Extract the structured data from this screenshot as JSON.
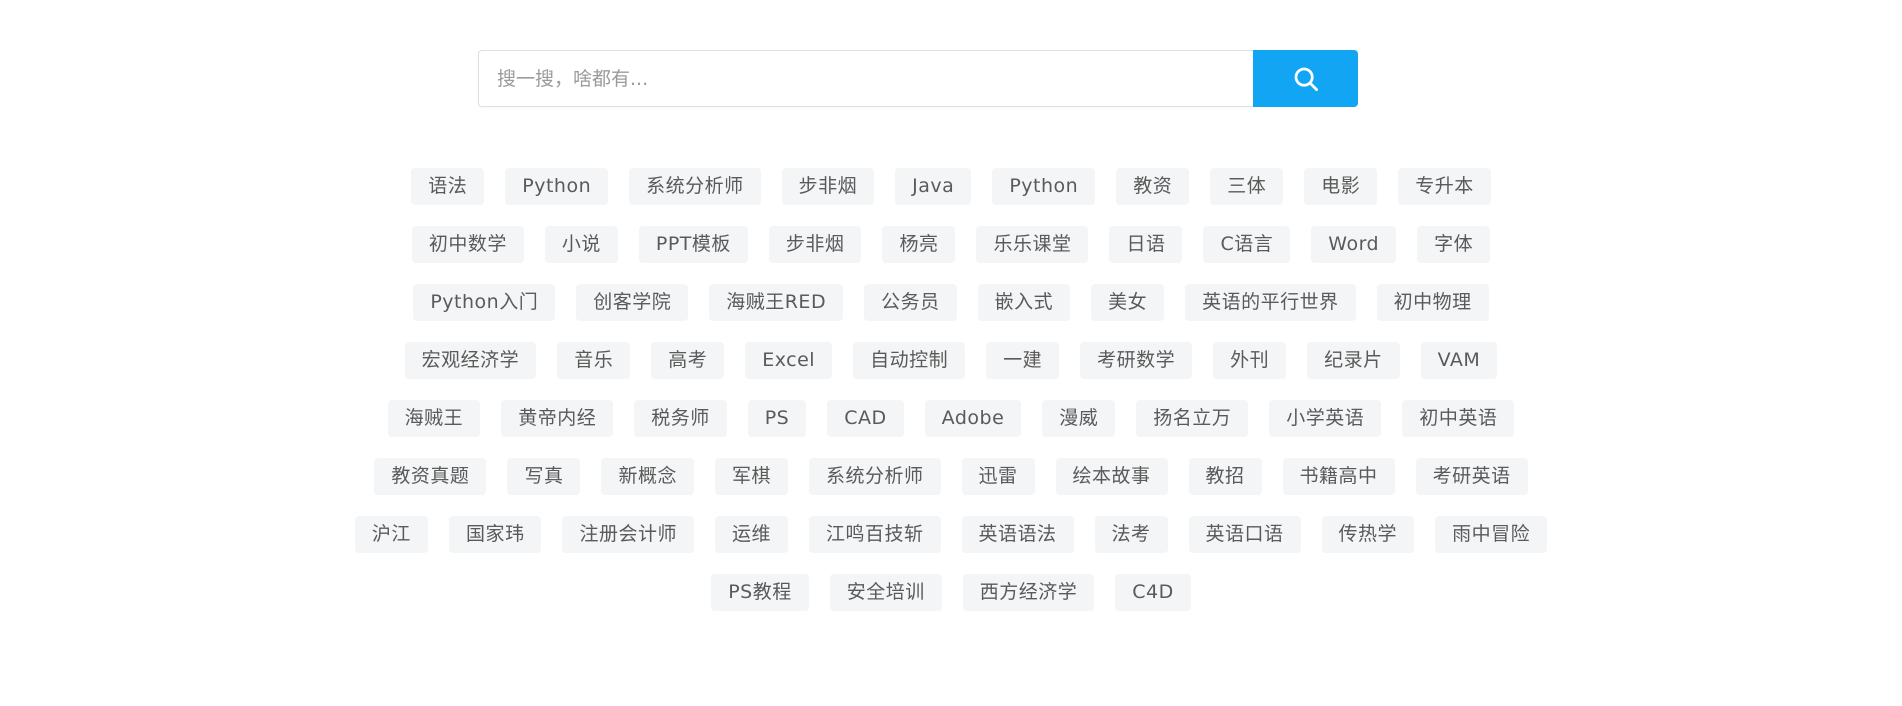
{
  "search": {
    "placeholder": "搜一搜，啥都有...",
    "value": "",
    "button_icon": "search-icon",
    "button_color": "#12a5f4"
  },
  "tag_cloud": {
    "tag_bg_color": "#f4f5f6",
    "tag_text_color": "#5a5a5a",
    "rows": [
      [
        "语法",
        "Python",
        "系统分析师",
        "步非烟",
        "Java",
        "Python",
        "教资",
        "三体",
        "电影",
        "专升本"
      ],
      [
        "初中数学",
        "小说",
        "PPT模板",
        "步非烟",
        "杨亮",
        "乐乐课堂",
        "日语",
        "C语言",
        "Word",
        "字体"
      ],
      [
        "Python入门",
        "创客学院",
        "海贼王RED",
        "公务员",
        "嵌入式",
        "美女",
        "英语的平行世界",
        "初中物理"
      ],
      [
        "宏观经济学",
        "音乐",
        "高考",
        "Excel",
        "自动控制",
        "一建",
        "考研数学",
        "外刊",
        "纪录片",
        "VAM"
      ],
      [
        "海贼王",
        "黄帝内经",
        "税务师",
        "PS",
        "CAD",
        "Adobe",
        "漫威",
        "扬名立万",
        "小学英语",
        "初中英语"
      ],
      [
        "教资真题",
        "写真",
        "新概念",
        "军棋",
        "系统分析师",
        "迅雷",
        "绘本故事",
        "教招",
        "书籍高中",
        "考研英语"
      ],
      [
        "沪江",
        "国家玮",
        "注册会计师",
        "运维",
        "江鸣百技斩",
        "英语语法",
        "法考",
        "英语口语",
        "传热学",
        "雨中冒险"
      ],
      [
        "PS教程",
        "安全培训",
        "西方经济学",
        "C4D"
      ]
    ]
  }
}
